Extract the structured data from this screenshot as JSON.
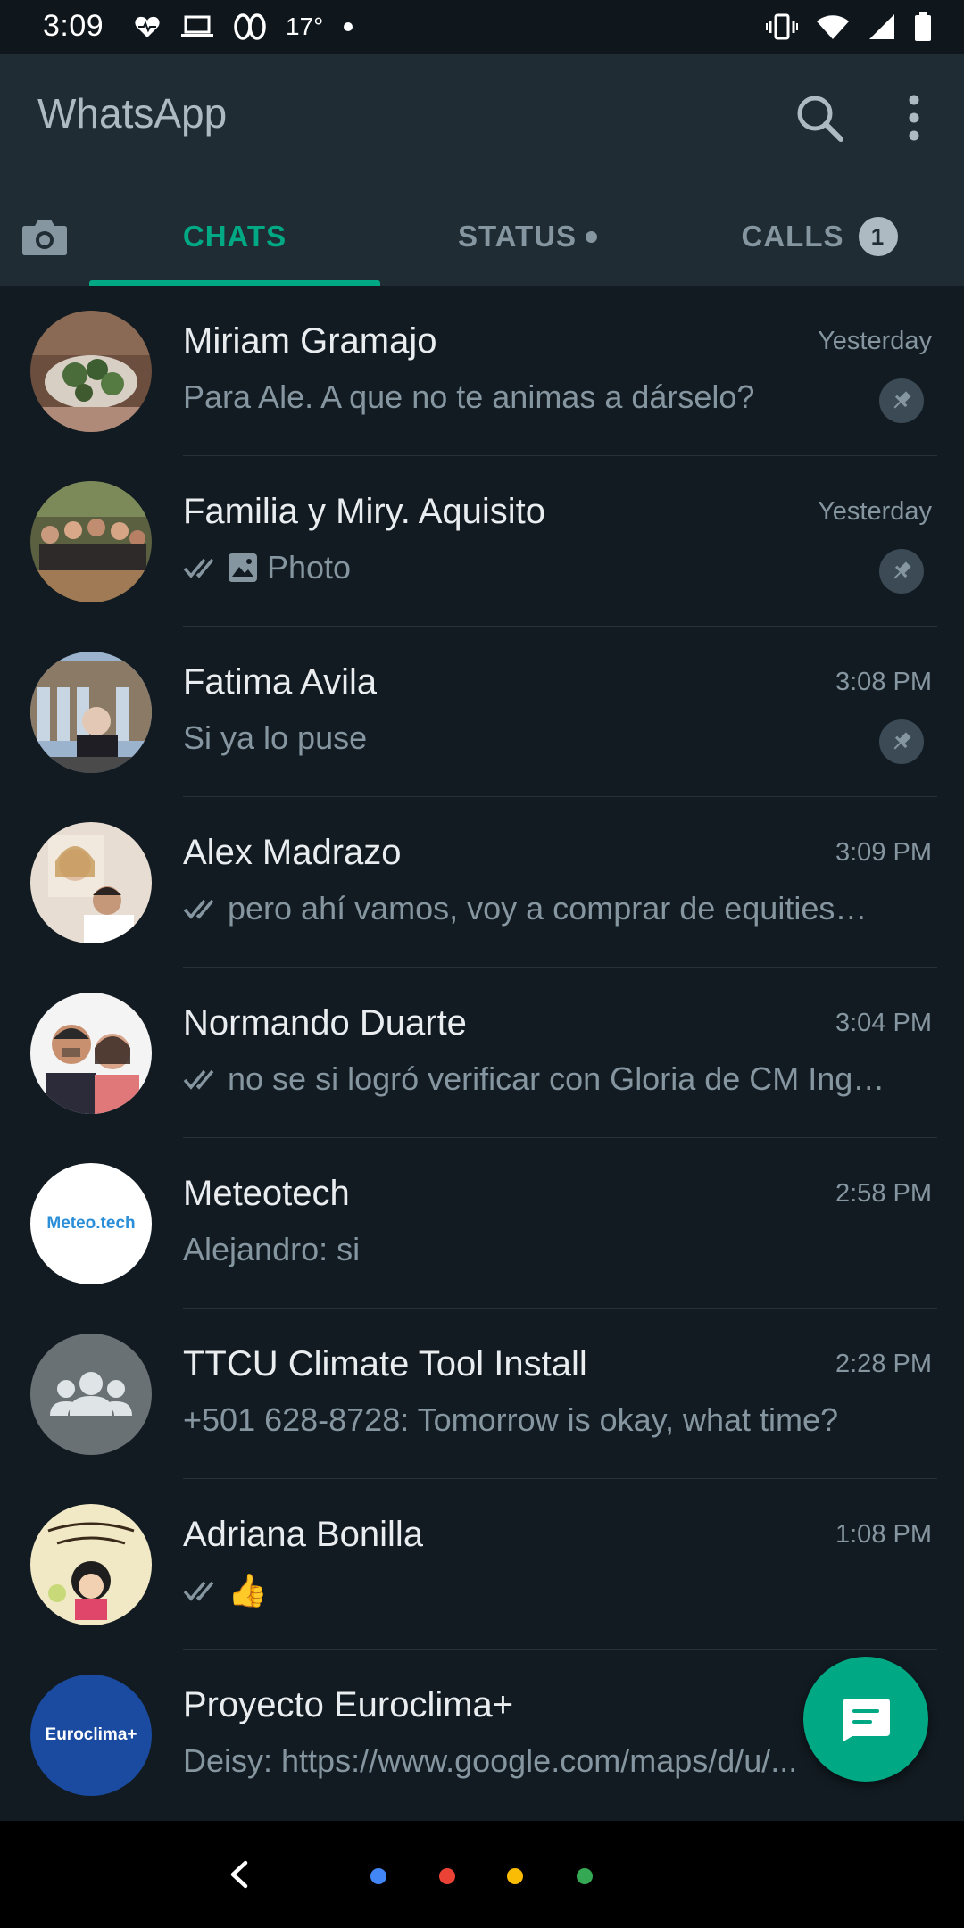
{
  "status_bar": {
    "time": "3:09",
    "temperature": "17°",
    "left_icons": [
      "heart-pulse-icon",
      "laptop-icon",
      "infinity-icon",
      "dot-icon"
    ],
    "right_icons": [
      "vibrate-icon",
      "wifi-icon",
      "signal-icon",
      "battery-icon"
    ]
  },
  "app_bar": {
    "title": "WhatsApp",
    "tabs": {
      "camera_icon": "camera-icon",
      "chats": "CHATS",
      "status": "STATUS",
      "calls": "CALLS",
      "calls_badge": "1"
    }
  },
  "colors": {
    "accent": "#00a884",
    "background": "#121b22",
    "header": "#1f2c34"
  },
  "chats": [
    {
      "name": "Miriam Gramajo",
      "time": "Yesterday",
      "preview": "Para Ale. A que no te animas a dárselo?",
      "pinned": true,
      "ticks": false,
      "photo": false
    },
    {
      "name": "Familia y Miry.  Aquisito",
      "time": "Yesterday",
      "preview": "Photo",
      "pinned": true,
      "ticks": true,
      "photo": true
    },
    {
      "name": "Fatima Avila",
      "time": "3:08 PM",
      "preview": "Si ya lo puse",
      "pinned": true,
      "ticks": false,
      "photo": false
    },
    {
      "name": "Alex Madrazo",
      "time": "3:09 PM",
      "preview": "pero ahí vamos, voy a comprar de equities…",
      "pinned": false,
      "ticks": true,
      "photo": false
    },
    {
      "name": "Normando Duarte",
      "time": "3:04 PM",
      "preview": "no se si logró verificar con Gloria de CM Ing…",
      "pinned": false,
      "ticks": true,
      "photo": false
    },
    {
      "name": "Meteotech",
      "time": "2:58 PM",
      "preview": "Alejandro: si",
      "pinned": false,
      "ticks": false,
      "photo": false,
      "avatar_text": "Meteo.tech"
    },
    {
      "name": "TTCU Climate Tool Install",
      "time": "2:28 PM",
      "preview": "+501 628-8728: Tomorrow is okay, what time?",
      "pinned": false,
      "ticks": false,
      "photo": false
    },
    {
      "name": "Adriana Bonilla",
      "time": "1:08 PM",
      "preview": "👍",
      "pinned": false,
      "ticks": true,
      "photo": false
    },
    {
      "name": "Proyecto Euroclima+",
      "time": "",
      "preview": "Deisy: https://www.google.com/maps/d/u/...",
      "pinned": false,
      "ticks": false,
      "photo": false,
      "avatar_text": "Euroclima+"
    }
  ],
  "fab": {
    "icon": "new-chat-icon"
  },
  "nav_bar": {
    "back_icon": "back-arrow-icon",
    "dot_colors": [
      "#4285f4",
      "#ea4335",
      "#fbbc05",
      "#34a853"
    ]
  }
}
